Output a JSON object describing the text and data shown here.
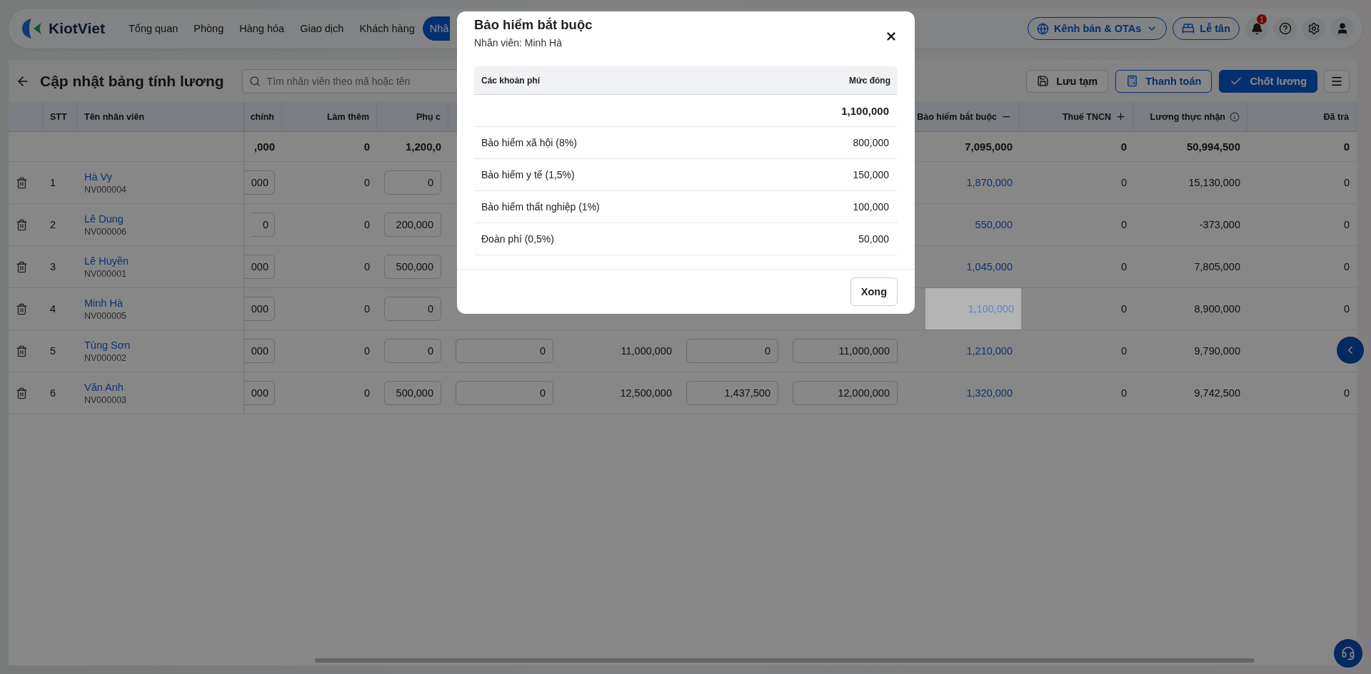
{
  "nav": {
    "logo": "KiotViet",
    "items": [
      {
        "label": "Tổng quan",
        "selected": false
      },
      {
        "label": "Phòng",
        "selected": false
      },
      {
        "label": "Hàng hóa",
        "selected": false
      },
      {
        "label": "Giao dịch",
        "selected": false
      },
      {
        "label": "Khách hàng",
        "selected": false
      },
      {
        "label": "Nhâ",
        "selected": true
      }
    ],
    "channel_button": "Kênh bán & OTAs",
    "reception_button": "Lễ tân",
    "notification_count": "1"
  },
  "page": {
    "title": "Cập nhật bảng tính lương",
    "search": {
      "placeholder": "Tìm nhân viên theo mã hoặc tên"
    },
    "actions": [
      {
        "label": "Lưu tạm",
        "kind": "save"
      },
      {
        "label": "Thanh toán",
        "kind": "pay"
      },
      {
        "label": "Chốt lương",
        "kind": "confirm"
      }
    ]
  },
  "table": {
    "frozen_columns": [
      "STT",
      "Tên nhân viên"
    ],
    "columns": [
      {
        "label": "chính",
        "kind": "input",
        "total": ",000"
      },
      {
        "label": "Làm thêm",
        "kind": "number",
        "total": "0"
      },
      {
        "label": "Phụ c",
        "kind": "input",
        "total": "1,200,0"
      },
      {
        "kind": "input"
      },
      {
        "kind": "number"
      },
      {
        "kind": "input"
      },
      {
        "kind": "input"
      },
      {
        "label": "Bảo hiểm bắt buộc",
        "kind": "link",
        "collapsible": true,
        "total": "7,095,000"
      },
      {
        "label": "Thuế TNCN",
        "kind": "number",
        "expandable": true,
        "total": "0"
      },
      {
        "label": "Lương thực nhận",
        "kind": "number",
        "has_info": true,
        "total": "50,994,500"
      },
      {
        "label": "Đã trả",
        "kind": "number",
        "total": "0"
      }
    ],
    "rows": [
      {
        "stt": "1",
        "name": "Hà Vy",
        "code": "NV000004",
        "selected": false,
        "cells": [
          {
            "value": "000"
          },
          {
            "value": "0"
          },
          {
            "value": "0"
          },
          {},
          {},
          {},
          {},
          {
            "value": "1,870,000"
          },
          {
            "value": "0"
          },
          {
            "value": "15,130,000"
          },
          {
            "value": "0"
          }
        ]
      },
      {
        "stt": "2",
        "name": "Lê Dung",
        "code": "NV000006",
        "selected": false,
        "cells": [
          {
            "value": "0"
          },
          {
            "value": "0"
          },
          {
            "value": "200,000"
          },
          {},
          {},
          {},
          {},
          {
            "value": "550,000"
          },
          {
            "value": "0"
          },
          {
            "value": "-373,000"
          },
          {
            "value": "0"
          }
        ]
      },
      {
        "stt": "3",
        "name": "Lê Huyền",
        "code": "NV000001",
        "selected": false,
        "cells": [
          {
            "value": "000"
          },
          {
            "value": "0"
          },
          {
            "value": "500,000"
          },
          {},
          {},
          {},
          {},
          {
            "value": "1,045,000"
          },
          {
            "value": "0"
          },
          {
            "value": "7,805,000"
          },
          {
            "value": "0"
          }
        ]
      },
      {
        "stt": "4",
        "name": "Minh Hà",
        "code": "NV000005",
        "selected": true,
        "cells": [
          {
            "value": "000"
          },
          {
            "value": "0"
          },
          {
            "value": "0"
          },
          {},
          {},
          {},
          {},
          {
            "value": "1,100,000"
          },
          {
            "value": "0"
          },
          {
            "value": "8,900,000"
          },
          {
            "value": "0"
          }
        ]
      },
      {
        "stt": "5",
        "name": "Tùng Sơn",
        "code": "NV000002",
        "selected": false,
        "cells": [
          {
            "value": "000"
          },
          {
            "value": "0"
          },
          {
            "value": "0"
          },
          {
            "value": "0"
          },
          {
            "value": "11,000,000"
          },
          {
            "value": "0"
          },
          {
            "value": "11,000,000"
          },
          {
            "value": "1,210,000"
          },
          {
            "value": "0"
          },
          {
            "value": "9,790,000"
          },
          {}
        ]
      },
      {
        "stt": "6",
        "name": "Văn Anh",
        "code": "NV000003",
        "selected": false,
        "cells": [
          {
            "value": "000"
          },
          {
            "value": "0"
          },
          {
            "value": "500,000"
          },
          {
            "value": "0"
          },
          {
            "value": "12,500,000"
          },
          {
            "value": "1,437,500"
          },
          {
            "value": "12,000,000"
          },
          {
            "value": "1,320,000"
          },
          {
            "value": "0"
          },
          {
            "value": "9,742,500"
          },
          {
            "value": "0"
          }
        ]
      }
    ]
  },
  "modal": {
    "title": "Bảo hiểm bắt buộc",
    "subtitle": "Nhân viên: Minh Hà",
    "columns": [
      "Các khoản phí",
      "Mức đóng"
    ],
    "total": "1,100,000",
    "items": [
      {
        "name": "Bảo hiểm xã hội (8%)",
        "amount": "800,000"
      },
      {
        "name": "Bảo hiểm y tế (1,5%)",
        "amount": "150,000"
      },
      {
        "name": "Bảo hiểm thất nghiệp (1%)",
        "amount": "100,000"
      },
      {
        "name": "Đoàn phí (0,5%)",
        "amount": "50,000"
      }
    ],
    "done_button": "Xong"
  }
}
